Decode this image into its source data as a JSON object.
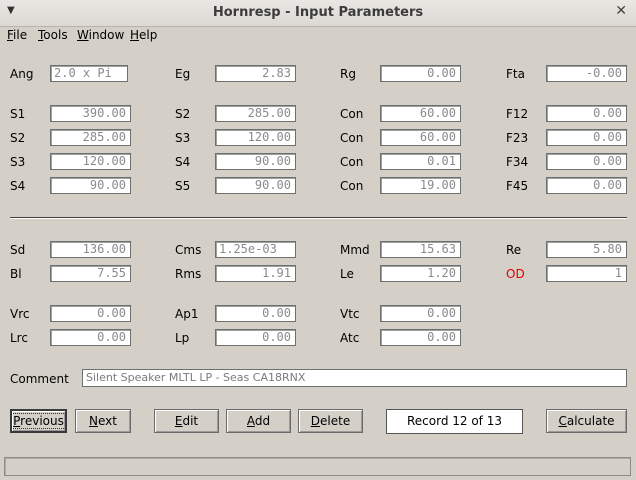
{
  "window": {
    "title": "Hornresp - Input Parameters",
    "sysmenu_glyph": "▼",
    "close_glyph": "✕"
  },
  "menu": [
    {
      "first": "F",
      "rest": "ile"
    },
    {
      "first": "T",
      "rest": "ools"
    },
    {
      "first": "W",
      "rest": "indow"
    },
    {
      "first": "H",
      "rest": "elp"
    }
  ],
  "params": {
    "ang": {
      "label": "Ang",
      "value": "2.0 x Pi"
    },
    "eg": {
      "label": "Eg",
      "value": "2.83"
    },
    "rg": {
      "label": "Rg",
      "value": "0.00"
    },
    "fta": {
      "label": "Fta",
      "value": "-0.00"
    },
    "r1": {
      "a_label": "S1",
      "a_value": "390.00",
      "b_label": "S2",
      "b_value": "285.00",
      "c_label": "Con",
      "c_value": "60.00",
      "d_label": "F12",
      "d_value": "0.00"
    },
    "r2": {
      "a_label": "S2",
      "a_value": "285.00",
      "b_label": "S3",
      "b_value": "120.00",
      "c_label": "Con",
      "c_value": "60.00",
      "d_label": "F23",
      "d_value": "0.00"
    },
    "r3": {
      "a_label": "S3",
      "a_value": "120.00",
      "b_label": "S4",
      "b_value": "90.00",
      "c_label": "Con",
      "c_value": "0.01",
      "d_label": "F34",
      "d_value": "0.00"
    },
    "r4": {
      "a_label": "S4",
      "a_value": "90.00",
      "b_label": "S5",
      "b_value": "90.00",
      "c_label": "Con",
      "c_value": "19.00",
      "d_label": "F45",
      "d_value": "0.00"
    },
    "sd": {
      "label": "Sd",
      "value": "136.00"
    },
    "cms": {
      "label": "Cms",
      "value": "1.25e-03"
    },
    "mmd": {
      "label": "Mmd",
      "value": "15.63"
    },
    "re": {
      "label": "Re",
      "value": "5.80"
    },
    "bl": {
      "label": "Bl",
      "value": "7.55"
    },
    "rms": {
      "label": "Rms",
      "value": "1.91"
    },
    "le": {
      "label": "Le",
      "value": "1.20"
    },
    "od": {
      "label": "OD",
      "value": "1"
    },
    "vrc": {
      "label": "Vrc",
      "value": "0.00"
    },
    "ap1": {
      "label": "Ap1",
      "value": "0.00"
    },
    "vtc": {
      "label": "Vtc",
      "value": "0.00"
    },
    "lrc": {
      "label": "Lrc",
      "value": "0.00"
    },
    "lp": {
      "label": "Lp",
      "value": "0.00"
    },
    "atc": {
      "label": "Atc",
      "value": "0.00"
    }
  },
  "comment": {
    "label": "Comment",
    "value": "Silent Speaker MLTL LP - Seas CA18RNX"
  },
  "buttons": {
    "previous": {
      "first": "P",
      "rest": "revious"
    },
    "next": {
      "first": "N",
      "rest": "ext"
    },
    "edit": {
      "first": "E",
      "rest": "dit"
    },
    "add": {
      "first": "A",
      "rest": "dd"
    },
    "delete": {
      "first": "D",
      "rest": "elete"
    },
    "calculate": {
      "first": "C",
      "rest": "alculate"
    }
  },
  "record": "Record 12 of 13",
  "status_text": "",
  "colors": {
    "background": "#d4d0c8",
    "od_label": "#e00000"
  }
}
